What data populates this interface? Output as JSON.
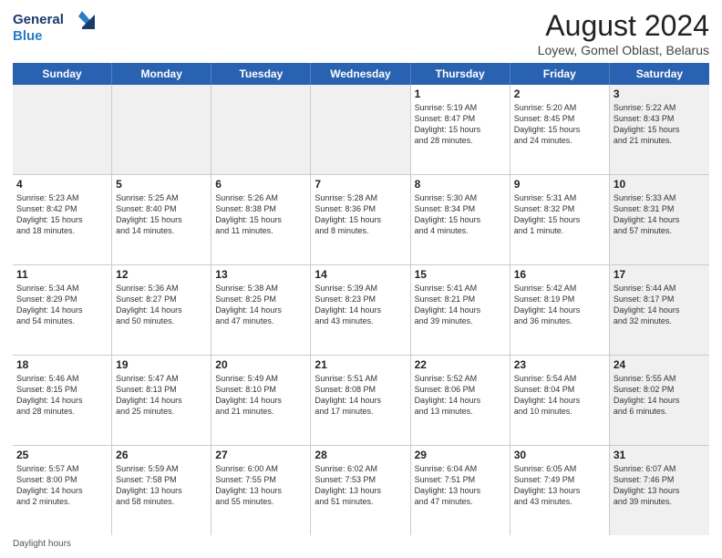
{
  "header": {
    "logo_line1": "General",
    "logo_line2": "Blue",
    "title": "August 2024",
    "subtitle": "Loyew, Gomel Oblast, Belarus"
  },
  "days_of_week": [
    "Sunday",
    "Monday",
    "Tuesday",
    "Wednesday",
    "Thursday",
    "Friday",
    "Saturday"
  ],
  "footer": "Daylight hours",
  "weeks": [
    [
      {
        "day": "",
        "info": "",
        "shaded": true
      },
      {
        "day": "",
        "info": "",
        "shaded": true
      },
      {
        "day": "",
        "info": "",
        "shaded": true
      },
      {
        "day": "",
        "info": "",
        "shaded": true
      },
      {
        "day": "1",
        "info": "Sunrise: 5:19 AM\nSunset: 8:47 PM\nDaylight: 15 hours\nand 28 minutes.",
        "shaded": false
      },
      {
        "day": "2",
        "info": "Sunrise: 5:20 AM\nSunset: 8:45 PM\nDaylight: 15 hours\nand 24 minutes.",
        "shaded": false
      },
      {
        "day": "3",
        "info": "Sunrise: 5:22 AM\nSunset: 8:43 PM\nDaylight: 15 hours\nand 21 minutes.",
        "shaded": true
      }
    ],
    [
      {
        "day": "4",
        "info": "Sunrise: 5:23 AM\nSunset: 8:42 PM\nDaylight: 15 hours\nand 18 minutes.",
        "shaded": false
      },
      {
        "day": "5",
        "info": "Sunrise: 5:25 AM\nSunset: 8:40 PM\nDaylight: 15 hours\nand 14 minutes.",
        "shaded": false
      },
      {
        "day": "6",
        "info": "Sunrise: 5:26 AM\nSunset: 8:38 PM\nDaylight: 15 hours\nand 11 minutes.",
        "shaded": false
      },
      {
        "day": "7",
        "info": "Sunrise: 5:28 AM\nSunset: 8:36 PM\nDaylight: 15 hours\nand 8 minutes.",
        "shaded": false
      },
      {
        "day": "8",
        "info": "Sunrise: 5:30 AM\nSunset: 8:34 PM\nDaylight: 15 hours\nand 4 minutes.",
        "shaded": false
      },
      {
        "day": "9",
        "info": "Sunrise: 5:31 AM\nSunset: 8:32 PM\nDaylight: 15 hours\nand 1 minute.",
        "shaded": false
      },
      {
        "day": "10",
        "info": "Sunrise: 5:33 AM\nSunset: 8:31 PM\nDaylight: 14 hours\nand 57 minutes.",
        "shaded": true
      }
    ],
    [
      {
        "day": "11",
        "info": "Sunrise: 5:34 AM\nSunset: 8:29 PM\nDaylight: 14 hours\nand 54 minutes.",
        "shaded": false
      },
      {
        "day": "12",
        "info": "Sunrise: 5:36 AM\nSunset: 8:27 PM\nDaylight: 14 hours\nand 50 minutes.",
        "shaded": false
      },
      {
        "day": "13",
        "info": "Sunrise: 5:38 AM\nSunset: 8:25 PM\nDaylight: 14 hours\nand 47 minutes.",
        "shaded": false
      },
      {
        "day": "14",
        "info": "Sunrise: 5:39 AM\nSunset: 8:23 PM\nDaylight: 14 hours\nand 43 minutes.",
        "shaded": false
      },
      {
        "day": "15",
        "info": "Sunrise: 5:41 AM\nSunset: 8:21 PM\nDaylight: 14 hours\nand 39 minutes.",
        "shaded": false
      },
      {
        "day": "16",
        "info": "Sunrise: 5:42 AM\nSunset: 8:19 PM\nDaylight: 14 hours\nand 36 minutes.",
        "shaded": false
      },
      {
        "day": "17",
        "info": "Sunrise: 5:44 AM\nSunset: 8:17 PM\nDaylight: 14 hours\nand 32 minutes.",
        "shaded": true
      }
    ],
    [
      {
        "day": "18",
        "info": "Sunrise: 5:46 AM\nSunset: 8:15 PM\nDaylight: 14 hours\nand 28 minutes.",
        "shaded": false
      },
      {
        "day": "19",
        "info": "Sunrise: 5:47 AM\nSunset: 8:13 PM\nDaylight: 14 hours\nand 25 minutes.",
        "shaded": false
      },
      {
        "day": "20",
        "info": "Sunrise: 5:49 AM\nSunset: 8:10 PM\nDaylight: 14 hours\nand 21 minutes.",
        "shaded": false
      },
      {
        "day": "21",
        "info": "Sunrise: 5:51 AM\nSunset: 8:08 PM\nDaylight: 14 hours\nand 17 minutes.",
        "shaded": false
      },
      {
        "day": "22",
        "info": "Sunrise: 5:52 AM\nSunset: 8:06 PM\nDaylight: 14 hours\nand 13 minutes.",
        "shaded": false
      },
      {
        "day": "23",
        "info": "Sunrise: 5:54 AM\nSunset: 8:04 PM\nDaylight: 14 hours\nand 10 minutes.",
        "shaded": false
      },
      {
        "day": "24",
        "info": "Sunrise: 5:55 AM\nSunset: 8:02 PM\nDaylight: 14 hours\nand 6 minutes.",
        "shaded": true
      }
    ],
    [
      {
        "day": "25",
        "info": "Sunrise: 5:57 AM\nSunset: 8:00 PM\nDaylight: 14 hours\nand 2 minutes.",
        "shaded": false
      },
      {
        "day": "26",
        "info": "Sunrise: 5:59 AM\nSunset: 7:58 PM\nDaylight: 13 hours\nand 58 minutes.",
        "shaded": false
      },
      {
        "day": "27",
        "info": "Sunrise: 6:00 AM\nSunset: 7:55 PM\nDaylight: 13 hours\nand 55 minutes.",
        "shaded": false
      },
      {
        "day": "28",
        "info": "Sunrise: 6:02 AM\nSunset: 7:53 PM\nDaylight: 13 hours\nand 51 minutes.",
        "shaded": false
      },
      {
        "day": "29",
        "info": "Sunrise: 6:04 AM\nSunset: 7:51 PM\nDaylight: 13 hours\nand 47 minutes.",
        "shaded": false
      },
      {
        "day": "30",
        "info": "Sunrise: 6:05 AM\nSunset: 7:49 PM\nDaylight: 13 hours\nand 43 minutes.",
        "shaded": false
      },
      {
        "day": "31",
        "info": "Sunrise: 6:07 AM\nSunset: 7:46 PM\nDaylight: 13 hours\nand 39 minutes.",
        "shaded": true
      }
    ]
  ]
}
